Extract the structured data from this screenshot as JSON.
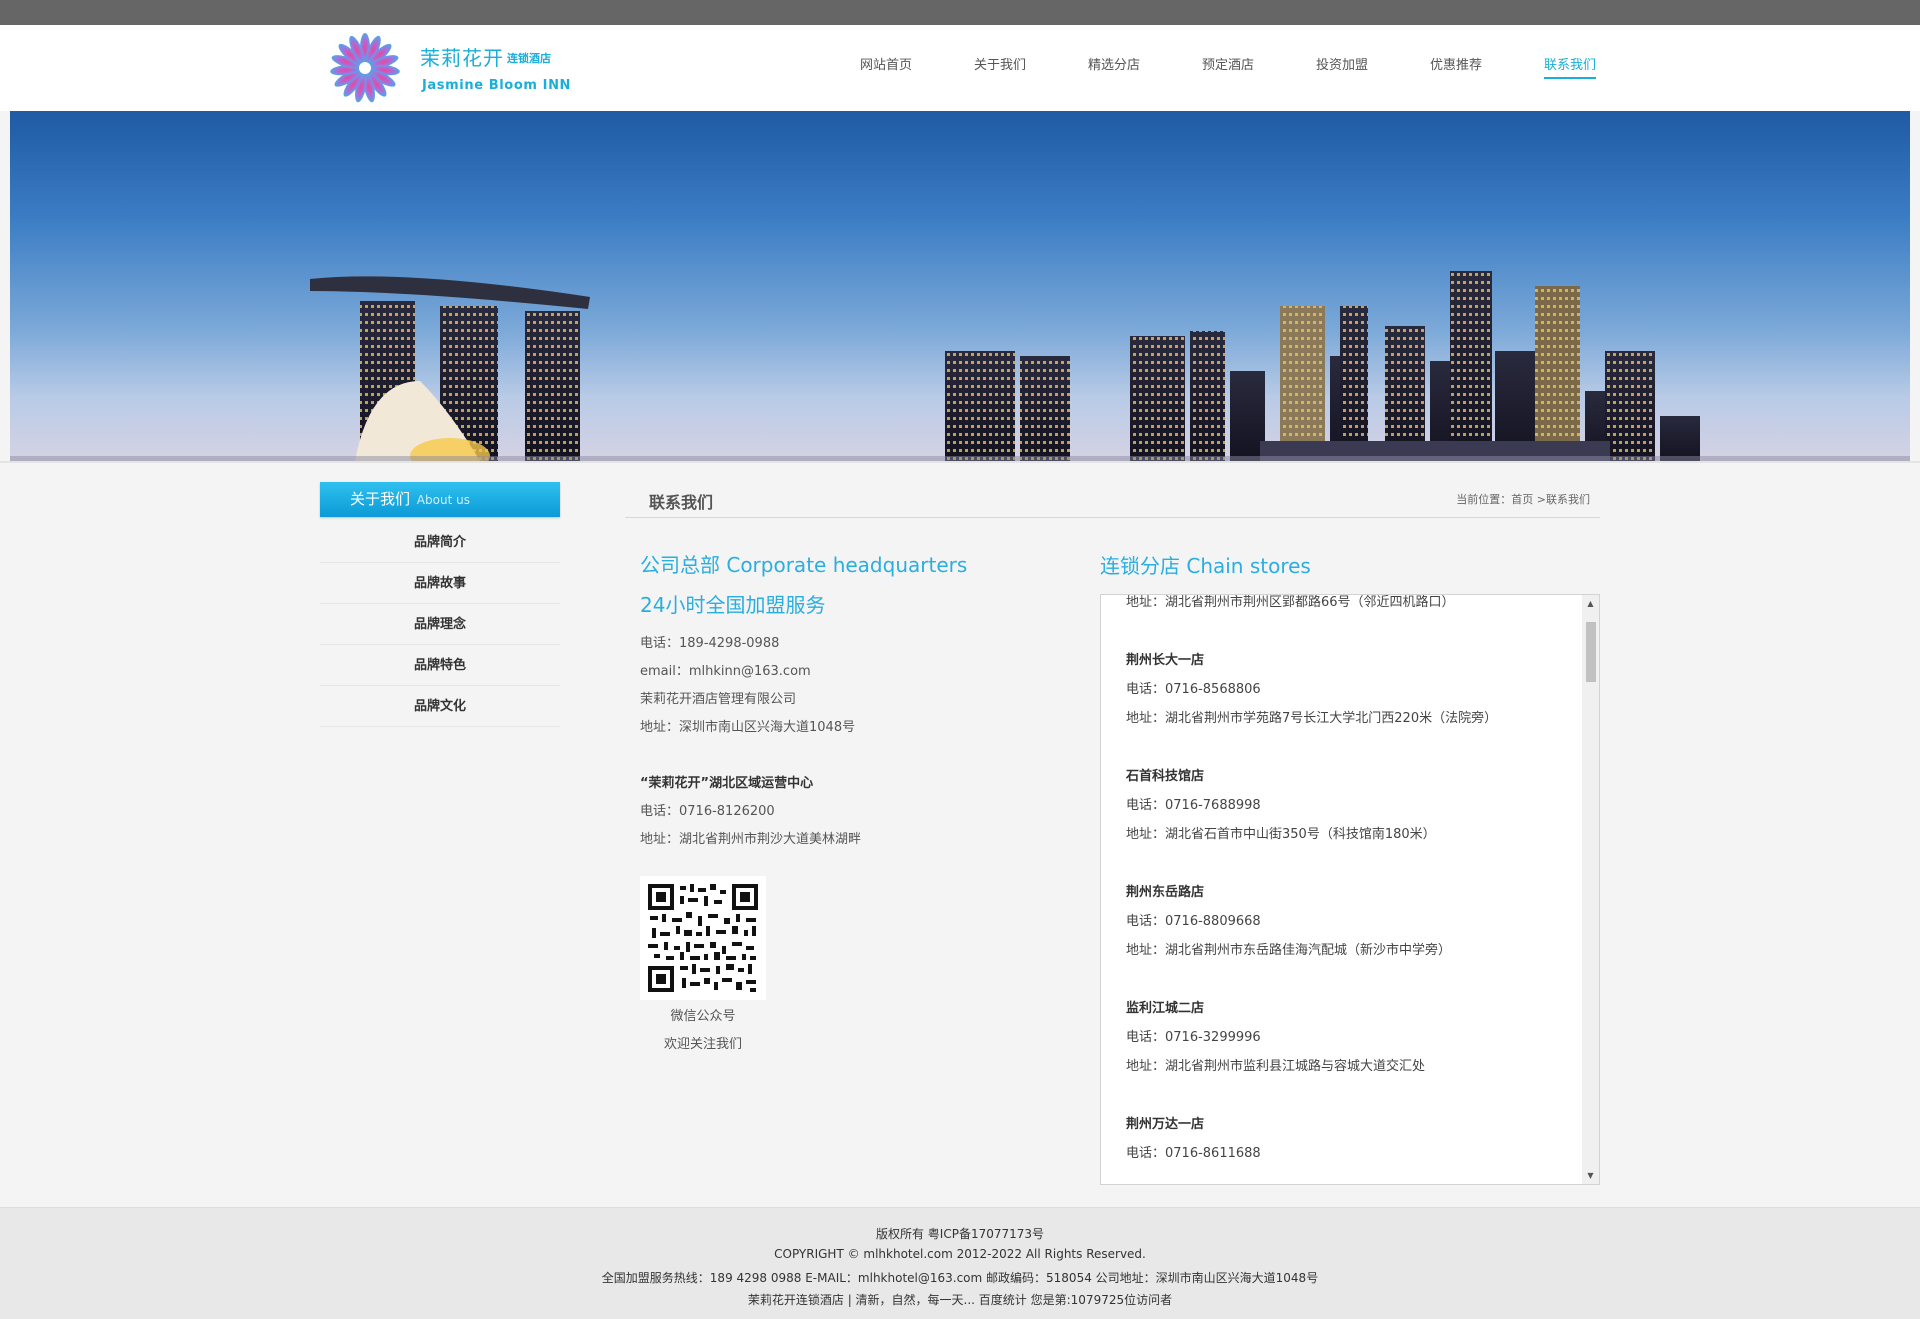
{
  "brand": {
    "name_cn": "茉莉花开",
    "name_sub": "连锁酒店",
    "name_en": "Jasmine Bloom  INN"
  },
  "nav": {
    "items": [
      {
        "label": "网站首页"
      },
      {
        "label": "关于我们"
      },
      {
        "label": "精选分店"
      },
      {
        "label": "预定酒店"
      },
      {
        "label": "投资加盟"
      },
      {
        "label": "优惠推荐"
      },
      {
        "label": "联系我们"
      }
    ],
    "active": "联系我们"
  },
  "sidebar": {
    "title": "关于我们",
    "title_en": "About us",
    "items": [
      {
        "label": "品牌简介"
      },
      {
        "label": "品牌故事"
      },
      {
        "label": "品牌理念"
      },
      {
        "label": "品牌特色"
      },
      {
        "label": "品牌文化"
      }
    ]
  },
  "main": {
    "title": "联系我们",
    "breadcrumb": "当前位置：首页 >联系我们"
  },
  "hq": {
    "title": "公司总部 Corporate headquarters",
    "service": "24小时全国加盟服务",
    "phone": "电话：189-4298-0988",
    "email": "email：mlhkinn@163.com",
    "company": "茉莉花开酒店管理有限公司",
    "address": "地址：深圳市南山区兴海大道1048号",
    "center_name": "“茉莉花开”湖北区域运营中心",
    "center_phone": "电话：0716-8126200",
    "center_address": "地址：湖北省荆州市荆沙大道美林湖畔",
    "qr_caption1": "微信公众号",
    "qr_caption2": "欢迎关注我们"
  },
  "chain": {
    "title": "连锁分店 Chain stores",
    "first_address": "地址：湖北省荆州市荆州区郢都路66号（邻近四机路口）",
    "stores": [
      {
        "name": "荆州长大一店",
        "phone": "电话：0716-8568806",
        "address": "地址：湖北省荆州市学苑路7号长江大学北门西220米（法院旁）"
      },
      {
        "name": "石首科技馆店",
        "phone": "电话：0716-7688998",
        "address": "地址：湖北省石首市中山街350号（科技馆南180米）"
      },
      {
        "name": "荆州东岳路店",
        "phone": "电话：0716-8809668",
        "address": "地址：湖北省荆州市东岳路佳海汽配城（新沙市中学旁）"
      },
      {
        "name": "监利江城二店",
        "phone": "电话：0716-3299996",
        "address": "地址：湖北省荆州市监利县江城路与容城大道交汇处"
      },
      {
        "name": "荆州万达一店",
        "phone": "电话：0716-8611688",
        "address": ""
      }
    ]
  },
  "footer": {
    "line1": "版权所有  粤ICP备17077173号",
    "line2": "COPYRIGHT © mlhkhotel.com 2012-2022 All Rights Reserved.",
    "line3": "全国加盟服务热线：189 4298 0988  E-MAIL：mlhkhotel@163.com  邮政编码：518054  公司地址：深圳市南山区兴海大道1048号",
    "line4": "茉莉花开连锁酒店 | 清新，自然，每一天... 百度统计 您是第:1079725位访问者"
  },
  "colors": {
    "accent": "#1aaed8",
    "topbar": "#666666",
    "footer_bg": "#e8e8e8"
  }
}
